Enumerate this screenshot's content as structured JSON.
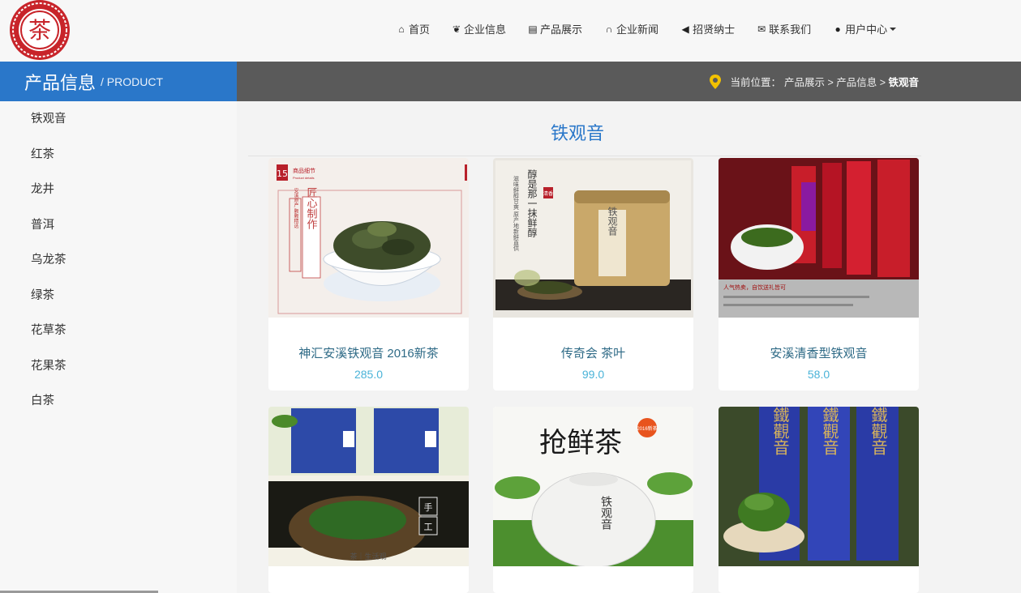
{
  "nav": {
    "items": [
      {
        "icon": "home-icon",
        "label": "首页"
      },
      {
        "icon": "leaf-icon",
        "label": "企业信息"
      },
      {
        "icon": "cart-icon",
        "label": "产品展示"
      },
      {
        "icon": "headphones-icon",
        "label": "企业新闻"
      },
      {
        "icon": "bullhorn-icon",
        "label": "招贤纳士"
      },
      {
        "icon": "envelope-icon",
        "label": "联系我们"
      },
      {
        "icon": "user-icon",
        "label": "用户中心"
      }
    ]
  },
  "band": {
    "title": "产品信息",
    "subtitle": "/ PRODUCT",
    "crumb_prefix": "当前位置：",
    "crumb_path": "产品展示 > 产品信息 > ",
    "crumb_current": "铁观音"
  },
  "sidebar": {
    "items": [
      "铁观音",
      "红茶",
      "龙井",
      "普洱",
      "乌龙茶",
      "绿茶",
      "花草茶",
      "花果茶",
      "白茶"
    ]
  },
  "main": {
    "heading": "铁观音",
    "products": [
      {
        "name": "神汇安溪铁观音 2016新茶",
        "price": "285.0"
      },
      {
        "name": "传奇会 茶叶",
        "price": "99.0"
      },
      {
        "name": "安溪清香型铁观音",
        "price": "58.0"
      },
      {
        "name": "",
        "price": ""
      },
      {
        "name": "",
        "price": ""
      },
      {
        "name": "",
        "price": ""
      }
    ],
    "card_texts": {
      "c1_tag": "商品细节",
      "c1_tag_en": "Product details",
      "c1_vert": "匠心制作",
      "c1_vert2": "安溪原产 颗颗精选",
      "c2_vert": "醇是那一抹鲜醇",
      "c2_vert2": "滋味鲜醇甘爽 原产地新鲜直供",
      "c2_can": "铁观音",
      "c2_badge": "清香",
      "c3_line1": "人气热卖，自饮送礼皆可",
      "c4_label": "茶｜生活观",
      "c4_hand": "手工",
      "c5_title": "抢鲜茶",
      "c5_badge": "2016新茶",
      "c5_jar": "铁观音",
      "c6_can": "鐵觀音"
    }
  },
  "colors": {
    "accent": "#2a77c9",
    "band": "#5a5a5a",
    "price": "#4ab3d8",
    "product_name": "#2e6a86"
  }
}
